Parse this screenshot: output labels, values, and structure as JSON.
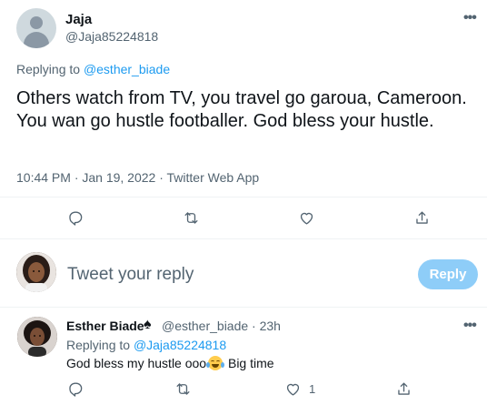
{
  "main_tweet": {
    "author": {
      "display_name": "Jaja",
      "handle": "@Jaja85224818"
    },
    "replying_to_prefix": "Replying to",
    "replying_to_handle": "@esther_biade",
    "text": "Others watch from TV, you travel go garoua, Cameroon. You wan go hustle footballer. God bless your hustle.",
    "timestamp": "10:44 PM · Jan 19, 2022 · Twitter Web App",
    "actions": [
      "reply-icon",
      "retweet-icon",
      "like-icon",
      "share-icon"
    ],
    "more_icon": "more-icon"
  },
  "composer": {
    "placeholder": "Tweet your reply",
    "button_label": "Reply",
    "button_color": "#8ecdf8"
  },
  "reply_tweet": {
    "author": {
      "display_name": "Esther Biade",
      "badge_icon": "spade-icon",
      "handle_time": "@esther_biade · 23h"
    },
    "replying_to_prefix": "Replying to",
    "replying_to_handle": "@Jaja85224818",
    "text_before_emoji": "God bless my hustle ooo",
    "emoji": "face-with-tears-of-joy",
    "text_after_emoji": " Big time",
    "like_count": "1",
    "actions": [
      "reply-icon",
      "retweet-icon",
      "like-icon",
      "share-icon"
    ]
  },
  "colors": {
    "link": "#1d9bf0",
    "secondary_text": "#536471",
    "primary_text": "#0f1419",
    "divider": "#eff3f4"
  }
}
